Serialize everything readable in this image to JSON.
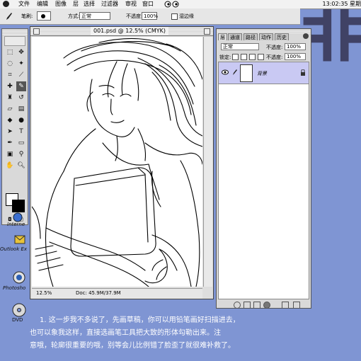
{
  "menubar": {
    "items": [
      "文件",
      "编辑",
      "图像",
      "层",
      "选择",
      "过滤器",
      "审视",
      "窗口"
    ],
    "clock": "13:02:35 星期"
  },
  "options_bar": {
    "brush_label": "笔刷:",
    "mode_label": "方式:",
    "mode_value": "正常",
    "opacity_label": "不透度:",
    "opacity_value": "100%",
    "wet_edges_label": "湿边缘"
  },
  "desktop": {
    "big_glyph": "非",
    "icons": [
      {
        "name": "internet-icon",
        "label": "Interne"
      },
      {
        "name": "outlook-express-icon",
        "label": "Outlook Ex"
      },
      {
        "name": "photoshop-icon",
        "label": "Photosho"
      },
      {
        "name": "dvd-icon",
        "label": "DVD"
      }
    ]
  },
  "document": {
    "title": "001.psd @ 12.5% (CMYK)",
    "zoom": "12.5%",
    "doc_size": "Doc: 45.9M/37.9M"
  },
  "layers_panel": {
    "tabs": [
      "层",
      "通道",
      "路径",
      "动作",
      "历史"
    ],
    "active_tab": 0,
    "blend_mode": "正常",
    "opacity_label": "不透度:",
    "opacity_value": "100%",
    "lock_label": "锁定:",
    "fill_label": "不透度:",
    "fill_value": "100%",
    "layer_name": "背景"
  },
  "caption": {
    "line1": "1. 这一步我不多说了，先画草稿，你可以用铅笔画好扫描进去，",
    "line2": "也可以象我这样，直接选画笔工具把大致的形体勾勒出来。注",
    "line3": "意哦，轮廓很重要的哦，别等会儿比例错了脸歪了就很难补救了。"
  },
  "colors": {
    "desktop": "#7f95d3",
    "selected_layer": "#c9c9f3"
  }
}
